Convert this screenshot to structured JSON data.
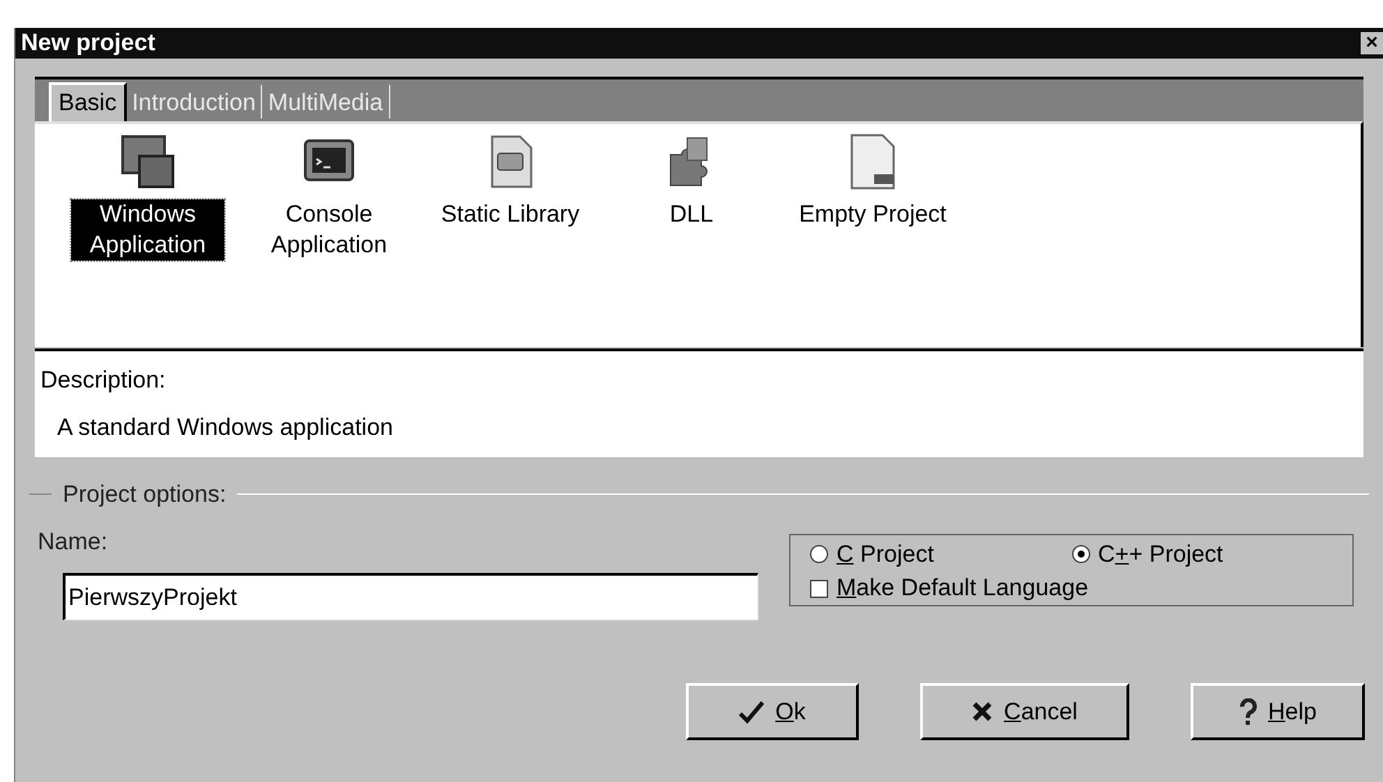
{
  "window": {
    "title": "New project",
    "close": "×"
  },
  "tabs": [
    {
      "label": "Basic",
      "selected": true
    },
    {
      "label": "Introduction",
      "selected": false
    },
    {
      "label": "MultiMedia",
      "selected": false
    }
  ],
  "templates": [
    {
      "kind": "windows",
      "label": "Windows Application",
      "selected": true
    },
    {
      "kind": "console",
      "label": "Console Application",
      "selected": false
    },
    {
      "kind": "library",
      "label": "Static Library",
      "selected": false
    },
    {
      "kind": "dll",
      "label": "DLL",
      "selected": false
    },
    {
      "kind": "empty",
      "label": "Empty Project",
      "selected": false
    }
  ],
  "description": {
    "heading": "Description:",
    "text": "A standard Windows application"
  },
  "project_options": {
    "legend": "Project options:",
    "name_label": "Name:",
    "name_value": "PierwszyProjekt"
  },
  "language": [
    {
      "key": "C",
      "after": " Project",
      "selected": false
    },
    {
      "before": "C",
      "key": "+",
      "after": "+ Project",
      "selected": true
    }
  ],
  "default_language": {
    "key": "M",
    "after": "ake Default Language",
    "checked": false
  },
  "buttons": [
    {
      "kind": "ok",
      "key": "O",
      "after": "k"
    },
    {
      "kind": "cancel",
      "key": "C",
      "after": "ancel"
    },
    {
      "kind": "help",
      "key": "H",
      "after": "elp"
    }
  ]
}
